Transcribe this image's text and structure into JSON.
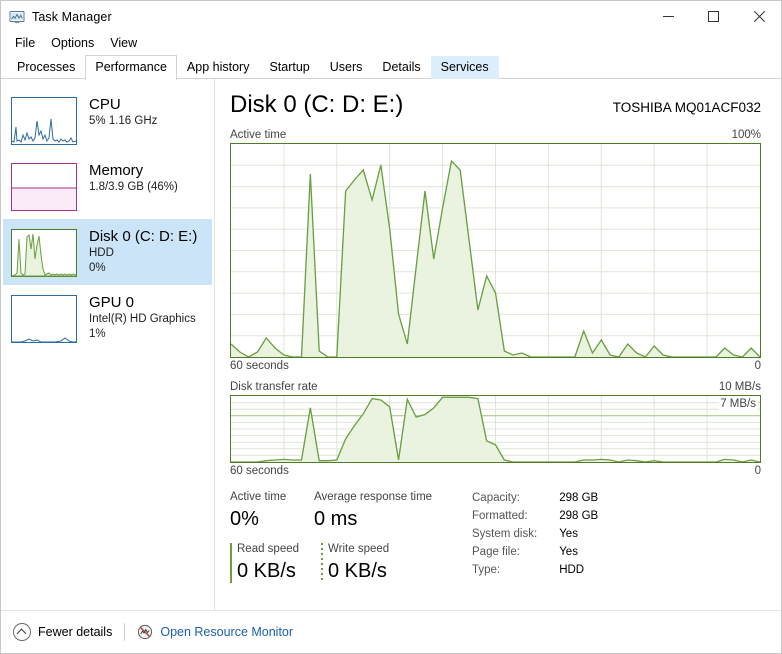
{
  "window": {
    "title": "Task Manager",
    "icon": "task-manager-icon",
    "minimize_label": "Minimize",
    "maximize_label": "Maximize",
    "close_label": "Close"
  },
  "menubar": {
    "items": [
      {
        "label": "File"
      },
      {
        "label": "Options"
      },
      {
        "label": "View"
      }
    ]
  },
  "tabs": [
    {
      "label": "Processes",
      "state": "normal"
    },
    {
      "label": "Performance",
      "state": "active"
    },
    {
      "label": "App history",
      "state": "normal"
    },
    {
      "label": "Startup",
      "state": "normal"
    },
    {
      "label": "Users",
      "state": "normal"
    },
    {
      "label": "Details",
      "state": "normal"
    },
    {
      "label": "Services",
      "state": "hover"
    }
  ],
  "sidebar": {
    "items": [
      {
        "name": "CPU",
        "title": "CPU",
        "line1": "5%  1.16 GHz",
        "line2": "",
        "selected": false,
        "accent": "#2b6ca3"
      },
      {
        "name": "Memory",
        "title": "Memory",
        "line1": "1.8/3.9 GB (46%)",
        "line2": "",
        "selected": false,
        "accent": "#a4308f"
      },
      {
        "name": "Disk 0",
        "title": "Disk 0 (C: D: E:)",
        "line1": "HDD",
        "line2": "0%",
        "selected": true,
        "accent": "#4f7a2a"
      },
      {
        "name": "GPU 0",
        "title": "GPU 0",
        "line1": "Intel(R) HD Graphics",
        "line2": "1%",
        "selected": false,
        "accent": "#2b6ca3"
      }
    ]
  },
  "main": {
    "title": "Disk 0 (C: D: E:)",
    "model": "TOSHIBA MQ01ACF032",
    "active_graph": {
      "label": "Active time",
      "max_label": "100%",
      "x_left_label": "60 seconds",
      "x_right_label": "0"
    },
    "transfer_graph": {
      "label": "Disk transfer rate",
      "max_label": "10 MB/s",
      "marker_label": "7 MB/s",
      "x_left_label": "60 seconds",
      "x_right_label": "0"
    },
    "stats": {
      "active_time_label": "Active time",
      "active_time_value": "0%",
      "avg_response_label": "Average response time",
      "avg_response_value": "0 ms",
      "read_speed_label": "Read speed",
      "read_speed_value": "0 KB/s",
      "write_speed_label": "Write speed",
      "write_speed_value": "0 KB/s"
    },
    "properties": [
      {
        "key": "Capacity:",
        "value": "298 GB"
      },
      {
        "key": "Formatted:",
        "value": "298 GB"
      },
      {
        "key": "System disk:",
        "value": "Yes"
      },
      {
        "key": "Page file:",
        "value": "Yes"
      },
      {
        "key": "Type:",
        "value": "HDD"
      }
    ]
  },
  "statusbar": {
    "fewer_details_label": "Fewer details",
    "resource_monitor_label": "Open Resource Monitor"
  },
  "colors": {
    "graph_line": "#6b9e3f",
    "graph_fill": "#e9f3e0",
    "graph_border": "#4f7a2a",
    "grid": "#dfe6d8",
    "selection": "#cce4f7",
    "link": "#1a5fb4",
    "cpu_accent": "#2b6ca3",
    "memory_accent": "#a4308f"
  },
  "chart_data": [
    {
      "type": "area",
      "title": "Active time",
      "ylabel": "Active time",
      "xlabel": "60 seconds",
      "ylim": [
        0,
        100
      ],
      "xlim": [
        60,
        0
      ],
      "unit": "%",
      "grid": true,
      "x": [
        0,
        1,
        2,
        3,
        4,
        5,
        6,
        7,
        8,
        9,
        10,
        11,
        12,
        13,
        14,
        15,
        16,
        17,
        18,
        19,
        20,
        21,
        22,
        23,
        24,
        25,
        26,
        27,
        28,
        29,
        30,
        31,
        32,
        33,
        34,
        35,
        36,
        37,
        38,
        39,
        40,
        41,
        42,
        43,
        44,
        45,
        46,
        47,
        48,
        49,
        50,
        51,
        52,
        53,
        54,
        55,
        56,
        57,
        58,
        59,
        60
      ],
      "values": [
        6,
        2,
        0,
        2,
        9,
        4,
        1,
        0,
        0,
        86,
        3,
        0,
        0,
        78,
        83,
        88,
        74,
        90,
        60,
        20,
        6,
        42,
        78,
        46,
        70,
        92,
        88,
        55,
        22,
        38,
        30,
        3,
        1,
        2,
        0,
        0,
        0,
        0,
        0,
        0,
        12,
        2,
        8,
        1,
        0,
        6,
        2,
        0,
        5,
        1,
        0,
        0,
        0,
        0,
        0,
        0,
        4,
        1,
        0,
        4,
        0
      ]
    },
    {
      "type": "area",
      "title": "Disk transfer rate",
      "ylabel": "Disk transfer rate",
      "xlabel": "60 seconds",
      "ylim": [
        0,
        10
      ],
      "xlim": [
        60,
        0
      ],
      "unit": "MB/s",
      "marker_value": 7,
      "grid": true,
      "x": [
        0,
        1,
        2,
        3,
        4,
        5,
        6,
        7,
        8,
        9,
        10,
        11,
        12,
        13,
        14,
        15,
        16,
        17,
        18,
        19,
        20,
        21,
        22,
        23,
        24,
        25,
        26,
        27,
        28,
        29,
        30,
        31,
        32,
        33,
        34,
        35,
        36,
        37,
        38,
        39,
        40,
        41,
        42,
        43,
        44,
        45,
        46,
        47,
        48,
        49,
        50,
        51,
        52,
        53,
        54,
        55,
        56,
        57,
        58,
        59,
        60
      ],
      "values": [
        0,
        0,
        0,
        0,
        0.2,
        0.3,
        0.4,
        0.3,
        0.3,
        8.2,
        0.2,
        0.2,
        0.3,
        3.5,
        5.5,
        7.3,
        9.6,
        9.4,
        8.5,
        0.3,
        9.5,
        6.8,
        7.2,
        8.2,
        9.8,
        9.8,
        9.8,
        9.8,
        9.6,
        3.2,
        2.6,
        0.3,
        0,
        0,
        0,
        0,
        0,
        0,
        0,
        0,
        0.3,
        0.3,
        0.4,
        0.3,
        0,
        0.3,
        0.2,
        0,
        0.2,
        0,
        0,
        0,
        0,
        0,
        0,
        0,
        0.4,
        0.3,
        0,
        0.3,
        0
      ]
    }
  ]
}
